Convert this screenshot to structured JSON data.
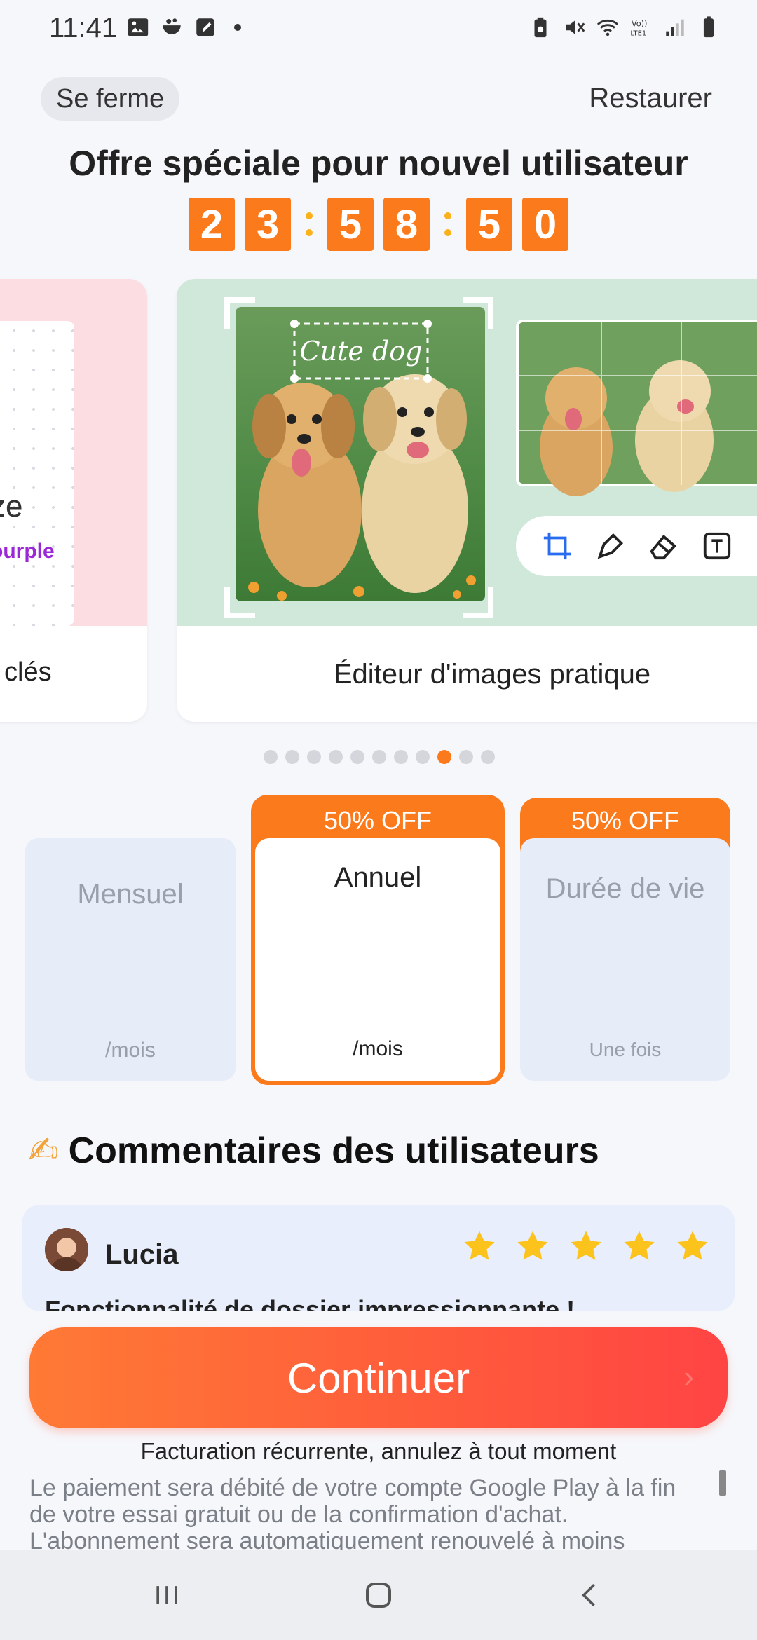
{
  "status_bar": {
    "time": "11:41"
  },
  "header": {
    "close_label": "Se ferme",
    "restore_label": "Restaurer",
    "title": "Offre spéciale pour nouvel utilisateur"
  },
  "countdown": {
    "digits": [
      "2",
      "3",
      "5",
      "8",
      "5",
      "0"
    ]
  },
  "carousel": {
    "left_card": {
      "word1": "ze",
      "word2": "ourple",
      "caption": "clés"
    },
    "main_card": {
      "sticker_text": "Cute dog",
      "caption": "Éditeur d'images pratique"
    },
    "dots_total": 11,
    "dots_active_index": 8
  },
  "plans": [
    {
      "name": "Mensuel",
      "price_suffix": "/mois",
      "badge": ""
    },
    {
      "name": "Annuel",
      "price_suffix": "/mois",
      "badge": "50% OFF",
      "selected": true
    },
    {
      "name": "Durée de vie",
      "price_suffix": "Une fois",
      "badge": "50% OFF"
    }
  ],
  "reviews": {
    "emoji": "✍",
    "title": "Commentaires des utilisateurs",
    "items": [
      {
        "name": "Lucia",
        "rating": 5,
        "snippet": "Fonctionnalité de dossier impressionnante !"
      }
    ]
  },
  "cta": {
    "continue_label": "Continuer",
    "billing_note": "Facturation récurrente, annulez à tout moment",
    "legal": "Le paiement sera débité de votre compte Google Play à la fin de votre essai gratuit ou de la confirmation d'achat. L'abonnement sera automatiquement renouvelé à moins"
  },
  "colors": {
    "accent": "#fb7a1c",
    "cta_start": "#ff7a35",
    "cta_end": "#ff4444",
    "plan_bg": "#e6ecf8"
  }
}
